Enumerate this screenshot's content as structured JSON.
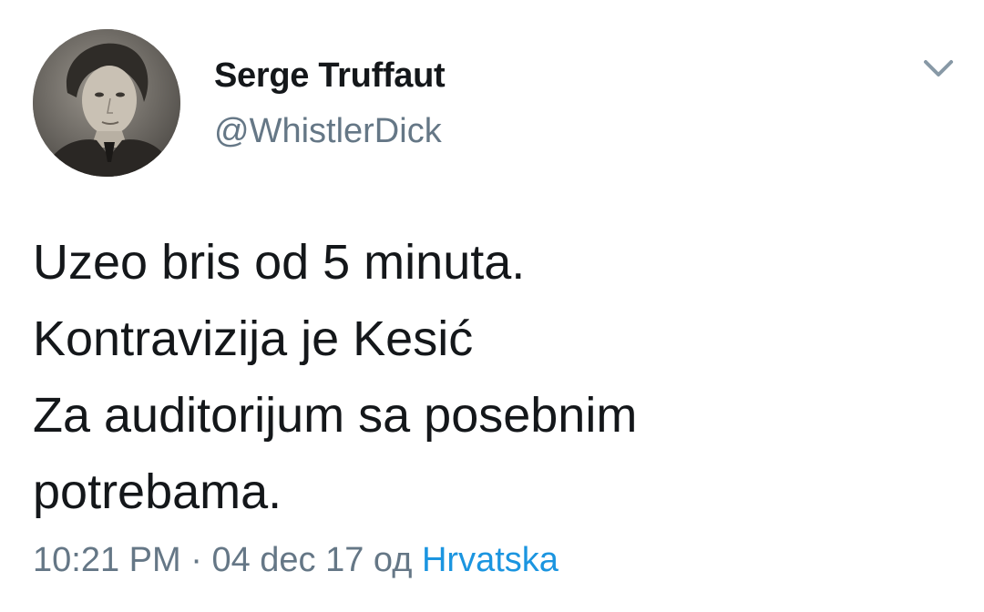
{
  "tweet": {
    "display_name": "Serge Truffaut",
    "handle": "@WhistlerDick",
    "text_lines": [
      "Uzeo bris od 5 minuta.",
      "Kontravizija je Kesić",
      "Za auditorijum sa posebnim",
      "potrebama."
    ],
    "time": "10:21 PM",
    "separator": "·",
    "date": "04 dec 17",
    "from_label": "од",
    "location": "Hrvatska"
  },
  "icons": {
    "caret": "chevron-down-icon",
    "avatar": "user-avatar-sketch-portrait"
  },
  "colors": {
    "name": "#14171a",
    "secondary": "#657786",
    "link": "#1b95e0",
    "background": "#ffffff"
  }
}
